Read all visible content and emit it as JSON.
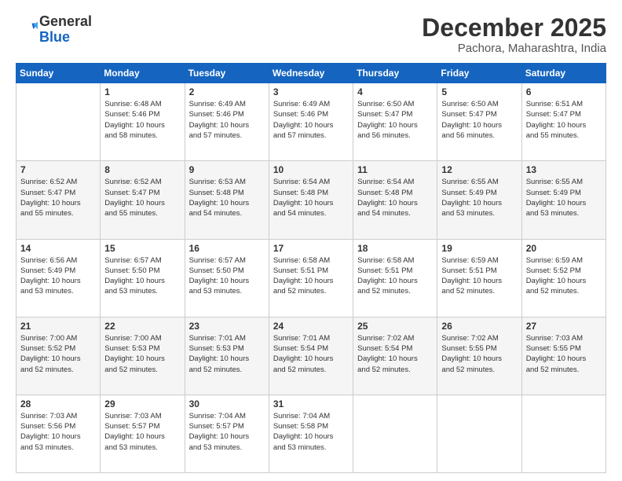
{
  "logo": {
    "general": "General",
    "blue": "Blue"
  },
  "title": "December 2025",
  "location": "Pachora, Maharashtra, India",
  "days_header": [
    "Sunday",
    "Monday",
    "Tuesday",
    "Wednesday",
    "Thursday",
    "Friday",
    "Saturday"
  ],
  "weeks": [
    [
      {
        "day": "",
        "info": ""
      },
      {
        "day": "1",
        "info": "Sunrise: 6:48 AM\nSunset: 5:46 PM\nDaylight: 10 hours\nand 58 minutes."
      },
      {
        "day": "2",
        "info": "Sunrise: 6:49 AM\nSunset: 5:46 PM\nDaylight: 10 hours\nand 57 minutes."
      },
      {
        "day": "3",
        "info": "Sunrise: 6:49 AM\nSunset: 5:46 PM\nDaylight: 10 hours\nand 57 minutes."
      },
      {
        "day": "4",
        "info": "Sunrise: 6:50 AM\nSunset: 5:47 PM\nDaylight: 10 hours\nand 56 minutes."
      },
      {
        "day": "5",
        "info": "Sunrise: 6:50 AM\nSunset: 5:47 PM\nDaylight: 10 hours\nand 56 minutes."
      },
      {
        "day": "6",
        "info": "Sunrise: 6:51 AM\nSunset: 5:47 PM\nDaylight: 10 hours\nand 55 minutes."
      }
    ],
    [
      {
        "day": "7",
        "info": "Sunrise: 6:52 AM\nSunset: 5:47 PM\nDaylight: 10 hours\nand 55 minutes."
      },
      {
        "day": "8",
        "info": "Sunrise: 6:52 AM\nSunset: 5:47 PM\nDaylight: 10 hours\nand 55 minutes."
      },
      {
        "day": "9",
        "info": "Sunrise: 6:53 AM\nSunset: 5:48 PM\nDaylight: 10 hours\nand 54 minutes."
      },
      {
        "day": "10",
        "info": "Sunrise: 6:54 AM\nSunset: 5:48 PM\nDaylight: 10 hours\nand 54 minutes."
      },
      {
        "day": "11",
        "info": "Sunrise: 6:54 AM\nSunset: 5:48 PM\nDaylight: 10 hours\nand 54 minutes."
      },
      {
        "day": "12",
        "info": "Sunrise: 6:55 AM\nSunset: 5:49 PM\nDaylight: 10 hours\nand 53 minutes."
      },
      {
        "day": "13",
        "info": "Sunrise: 6:55 AM\nSunset: 5:49 PM\nDaylight: 10 hours\nand 53 minutes."
      }
    ],
    [
      {
        "day": "14",
        "info": "Sunrise: 6:56 AM\nSunset: 5:49 PM\nDaylight: 10 hours\nand 53 minutes."
      },
      {
        "day": "15",
        "info": "Sunrise: 6:57 AM\nSunset: 5:50 PM\nDaylight: 10 hours\nand 53 minutes."
      },
      {
        "day": "16",
        "info": "Sunrise: 6:57 AM\nSunset: 5:50 PM\nDaylight: 10 hours\nand 53 minutes."
      },
      {
        "day": "17",
        "info": "Sunrise: 6:58 AM\nSunset: 5:51 PM\nDaylight: 10 hours\nand 52 minutes."
      },
      {
        "day": "18",
        "info": "Sunrise: 6:58 AM\nSunset: 5:51 PM\nDaylight: 10 hours\nand 52 minutes."
      },
      {
        "day": "19",
        "info": "Sunrise: 6:59 AM\nSunset: 5:51 PM\nDaylight: 10 hours\nand 52 minutes."
      },
      {
        "day": "20",
        "info": "Sunrise: 6:59 AM\nSunset: 5:52 PM\nDaylight: 10 hours\nand 52 minutes."
      }
    ],
    [
      {
        "day": "21",
        "info": "Sunrise: 7:00 AM\nSunset: 5:52 PM\nDaylight: 10 hours\nand 52 minutes."
      },
      {
        "day": "22",
        "info": "Sunrise: 7:00 AM\nSunset: 5:53 PM\nDaylight: 10 hours\nand 52 minutes."
      },
      {
        "day": "23",
        "info": "Sunrise: 7:01 AM\nSunset: 5:53 PM\nDaylight: 10 hours\nand 52 minutes."
      },
      {
        "day": "24",
        "info": "Sunrise: 7:01 AM\nSunset: 5:54 PM\nDaylight: 10 hours\nand 52 minutes."
      },
      {
        "day": "25",
        "info": "Sunrise: 7:02 AM\nSunset: 5:54 PM\nDaylight: 10 hours\nand 52 minutes."
      },
      {
        "day": "26",
        "info": "Sunrise: 7:02 AM\nSunset: 5:55 PM\nDaylight: 10 hours\nand 52 minutes."
      },
      {
        "day": "27",
        "info": "Sunrise: 7:03 AM\nSunset: 5:55 PM\nDaylight: 10 hours\nand 52 minutes."
      }
    ],
    [
      {
        "day": "28",
        "info": "Sunrise: 7:03 AM\nSunset: 5:56 PM\nDaylight: 10 hours\nand 53 minutes."
      },
      {
        "day": "29",
        "info": "Sunrise: 7:03 AM\nSunset: 5:57 PM\nDaylight: 10 hours\nand 53 minutes."
      },
      {
        "day": "30",
        "info": "Sunrise: 7:04 AM\nSunset: 5:57 PM\nDaylight: 10 hours\nand 53 minutes."
      },
      {
        "day": "31",
        "info": "Sunrise: 7:04 AM\nSunset: 5:58 PM\nDaylight: 10 hours\nand 53 minutes."
      },
      {
        "day": "",
        "info": ""
      },
      {
        "day": "",
        "info": ""
      },
      {
        "day": "",
        "info": ""
      }
    ]
  ]
}
